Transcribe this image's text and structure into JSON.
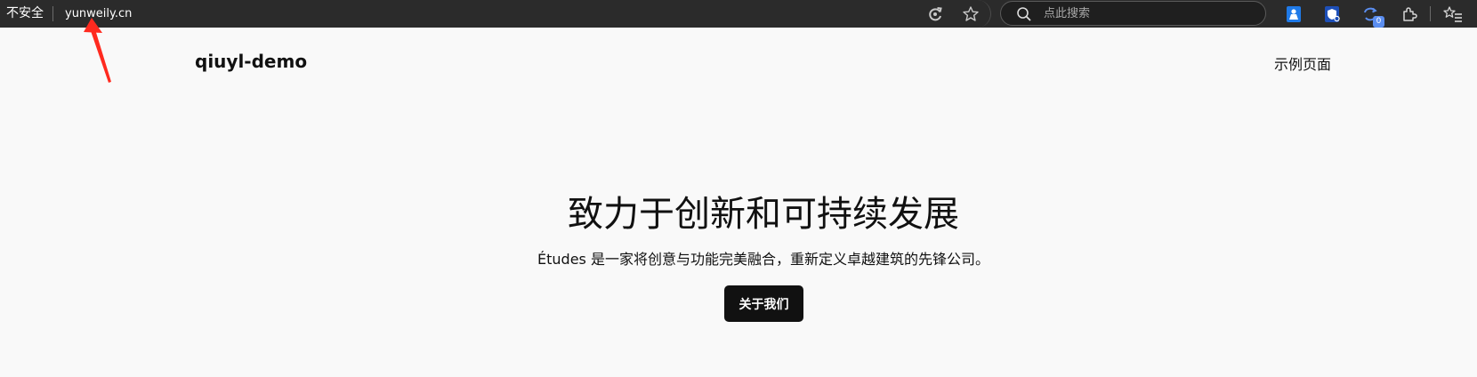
{
  "browser": {
    "security_label": "不安全",
    "url": "yunweily.cn",
    "search_placeholder": "点此搜索",
    "extension_badge": "0",
    "icons": [
      "refresh-icon",
      "favorite-star-icon",
      "search-icon",
      "extension-person-icon",
      "extension-shield-icon",
      "extension-sync-icon",
      "extensions-puzzle-icon",
      "favorites-list-icon"
    ],
    "annotation_color": "#ff2a1f"
  },
  "site": {
    "title": "qiuyl-demo",
    "nav_link": "示例页面"
  },
  "hero": {
    "title": "致力于创新和可持续发展",
    "subtitle": "Études 是一家将创意与功能完美融合，重新定义卓越建筑的先锋公司。",
    "button_label": "关于我们"
  }
}
